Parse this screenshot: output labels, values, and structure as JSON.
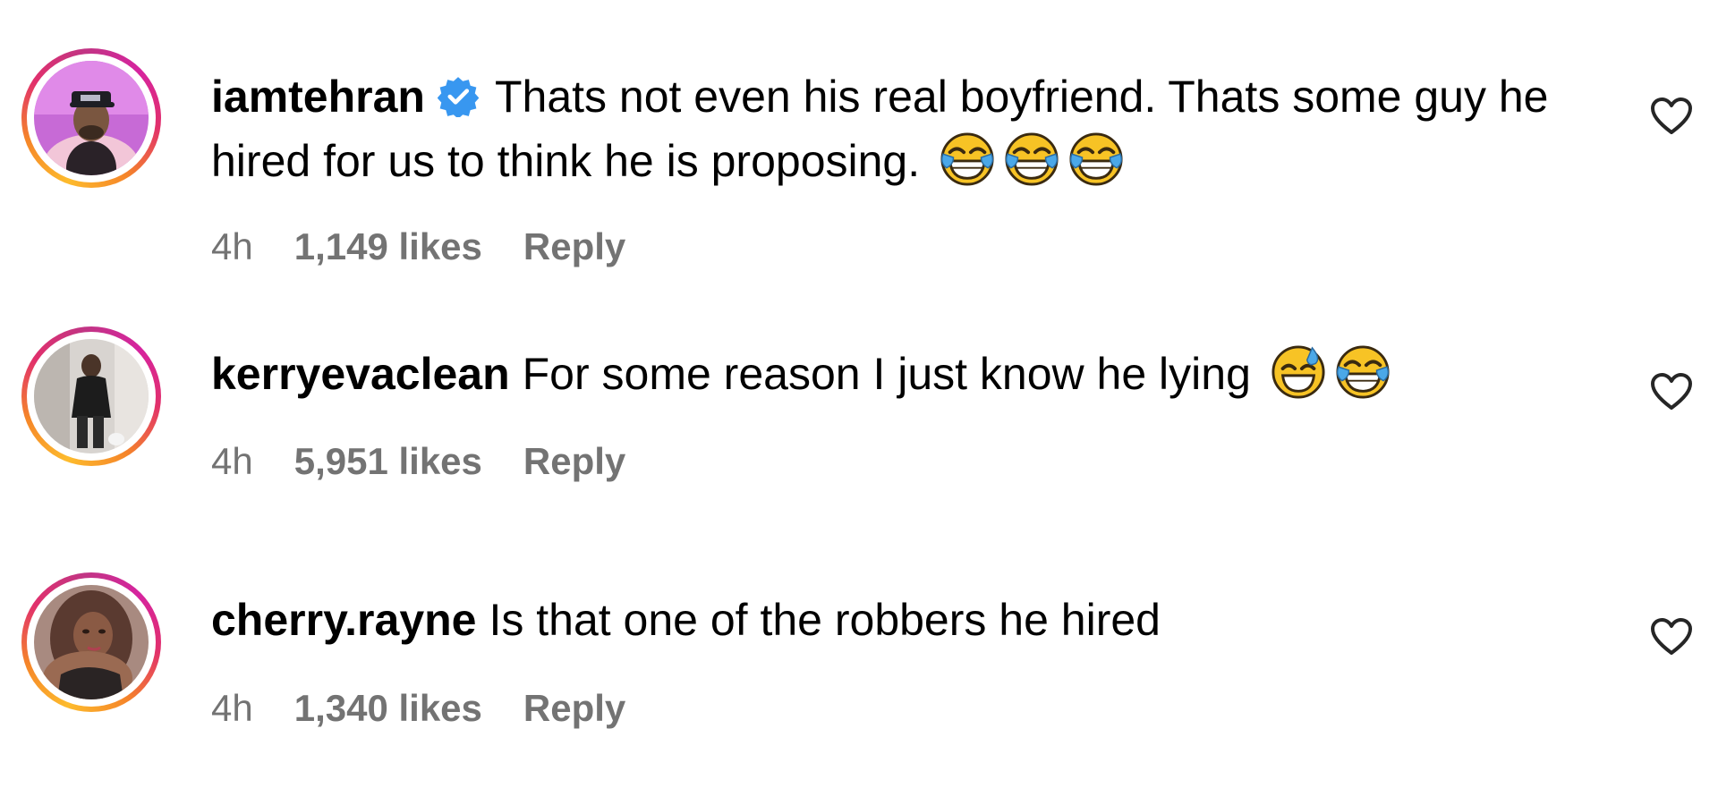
{
  "comments": [
    {
      "username": "iamtehran",
      "verified": true,
      "text": "Thats not even his real boyfriend. Thats some guy he hired for us to think he is proposing.",
      "emojis": [
        "face-with-tears-of-joy",
        "face-with-tears-of-joy",
        "face-with-tears-of-joy"
      ],
      "time": "4h",
      "likes": "1,149 likes",
      "reply": "Reply"
    },
    {
      "username": "kerryevaclean",
      "verified": false,
      "text": "For some reason I just know he lying",
      "emojis": [
        "grinning-face-with-sweat",
        "face-with-tears-of-joy"
      ],
      "time": "4h",
      "likes": "5,951 likes",
      "reply": "Reply"
    },
    {
      "username": "cherry.rayne",
      "verified": false,
      "text": "Is that one of the robbers he hired",
      "emojis": [],
      "time": "4h",
      "likes": "1,340 likes",
      "reply": "Reply"
    }
  ],
  "colors": {
    "meta_gray": "#737373",
    "verified_blue": "#3897f0"
  },
  "icons": {
    "like": "heart-outline-icon",
    "verified": "verified-badge-icon"
  }
}
